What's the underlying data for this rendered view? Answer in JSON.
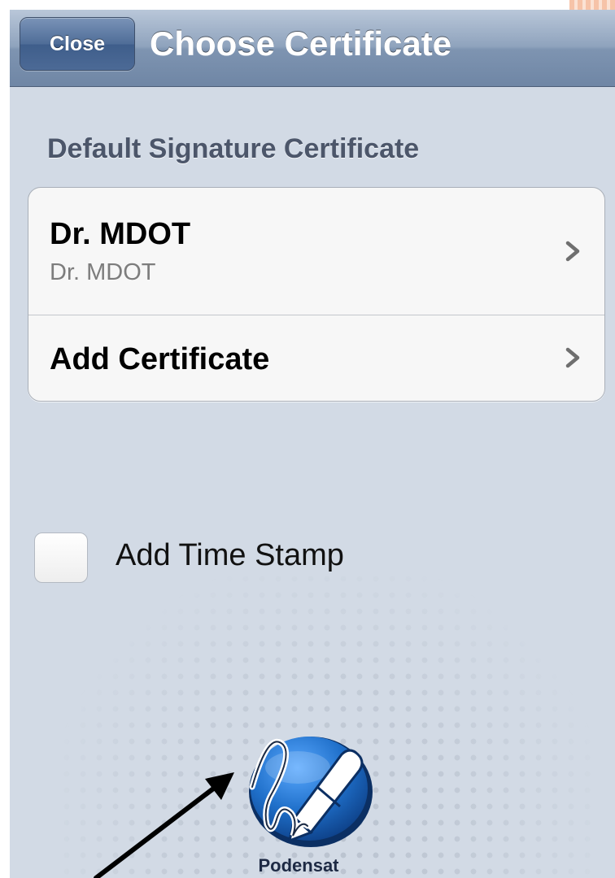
{
  "nav": {
    "close_label": "Close",
    "title": "Choose Certificate"
  },
  "section": {
    "header": "Default Signature Certificate"
  },
  "certificates": [
    {
      "title": "Dr. MDOT",
      "subtitle": "Dr. MDOT"
    },
    {
      "title": "Add Certificate"
    }
  ],
  "timestamp": {
    "label": "Add Time Stamp",
    "checked": false
  },
  "brand": {
    "name": "Podensat"
  },
  "icons": {
    "chevron": "chevron-right-icon",
    "logo": "signature-pen-logo-icon",
    "arrow": "callout-arrow-icon"
  },
  "colors": {
    "navbar": "#7e94b1",
    "background": "#d2dae5",
    "section_text": "#4c566a",
    "logo_blue": "#1f6fc9",
    "corner_accent": "#f6c3a8"
  }
}
